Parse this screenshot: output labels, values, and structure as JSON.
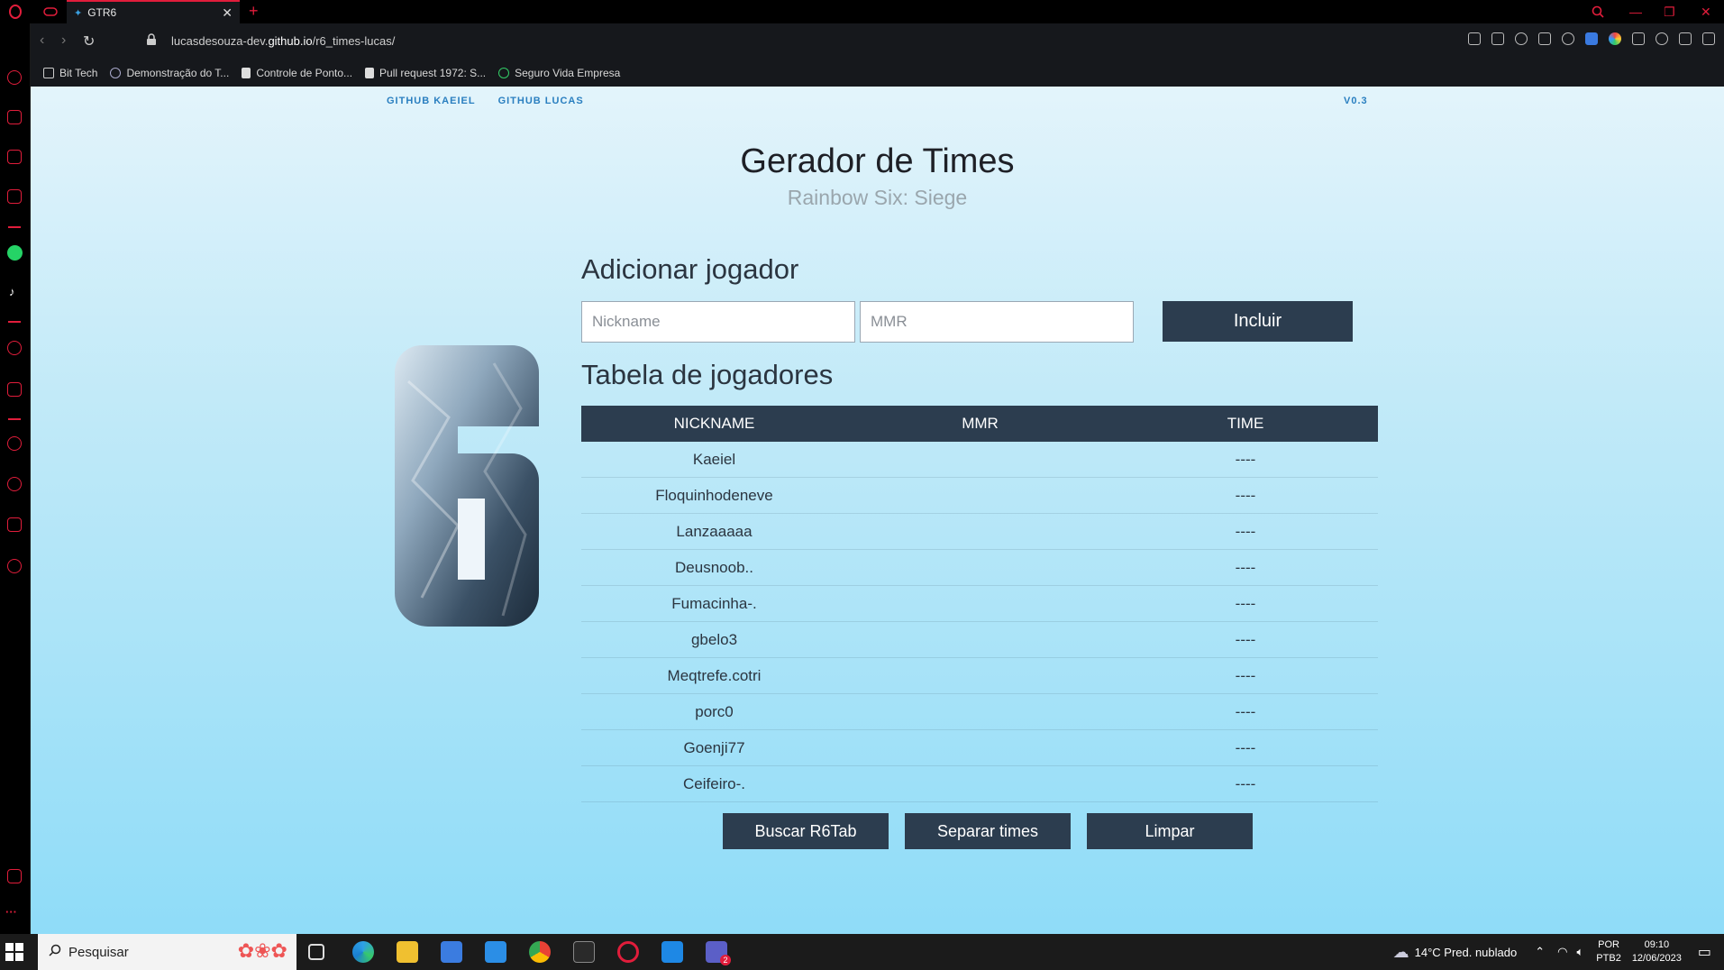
{
  "browser": {
    "tab_title": "GTR6",
    "url_prefix": "lucasdesouza-dev.",
    "url_host": "github.io",
    "url_path": "/r6_times-lucas/",
    "bookmarks": [
      {
        "label": "Bit Tech",
        "icon": "folder-icon"
      },
      {
        "label": "Demonstração do T...",
        "icon": "globe-icon"
      },
      {
        "label": "Controle de Ponto...",
        "icon": "document-icon"
      },
      {
        "label": "Pull request 1972: S...",
        "icon": "document-icon"
      },
      {
        "label": "Seguro Vida Empresa",
        "icon": "green-logo-icon"
      }
    ]
  },
  "page": {
    "nav": {
      "github_kaeiel": "GITHUB KAEIEL",
      "github_lucas": "GITHUB LUCAS"
    },
    "version": "V0.3",
    "title": "Gerador de Times",
    "subtitle": "Rainbow Six: Siege",
    "add_section": {
      "heading": "Adicionar jogador",
      "nickname_placeholder": "Nickname",
      "mmr_placeholder": "MMR",
      "include_button": "Incluir"
    },
    "table_section": {
      "heading": "Tabela de jogadores",
      "columns": [
        "NICKNAME",
        "MMR",
        "TIME"
      ],
      "rows": [
        {
          "nickname": "Kaeiel",
          "mmr": "",
          "time": "----"
        },
        {
          "nickname": "Floquinhodeneve",
          "mmr": "",
          "time": "----"
        },
        {
          "nickname": "Lanzaaaaa",
          "mmr": "",
          "time": "----"
        },
        {
          "nickname": "Deusnoob..",
          "mmr": "",
          "time": "----"
        },
        {
          "nickname": "Fumacinha-.",
          "mmr": "",
          "time": "----"
        },
        {
          "nickname": "gbelo3",
          "mmr": "",
          "time": "----"
        },
        {
          "nickname": "Meqtrefe.cotri",
          "mmr": "",
          "time": "----"
        },
        {
          "nickname": "porc0",
          "mmr": "",
          "time": "----"
        },
        {
          "nickname": "Goenji77",
          "mmr": "",
          "time": "----"
        },
        {
          "nickname": "Ceifeiro-.",
          "mmr": "",
          "time": "----"
        }
      ]
    },
    "buttons": {
      "search": "Buscar R6Tab",
      "split": "Separar times",
      "clear": "Limpar"
    }
  },
  "taskbar": {
    "search_placeholder": "Pesquisar",
    "weather": "14°C  Pred. nublado",
    "lang_1": "POR",
    "lang_2": "PTB2",
    "time": "09:10",
    "date": "12/06/2023",
    "teams_badge": "2"
  },
  "colors": {
    "accent": "#e11d3b",
    "table_header": "#2c3d4f",
    "link": "#2a7fc0"
  }
}
